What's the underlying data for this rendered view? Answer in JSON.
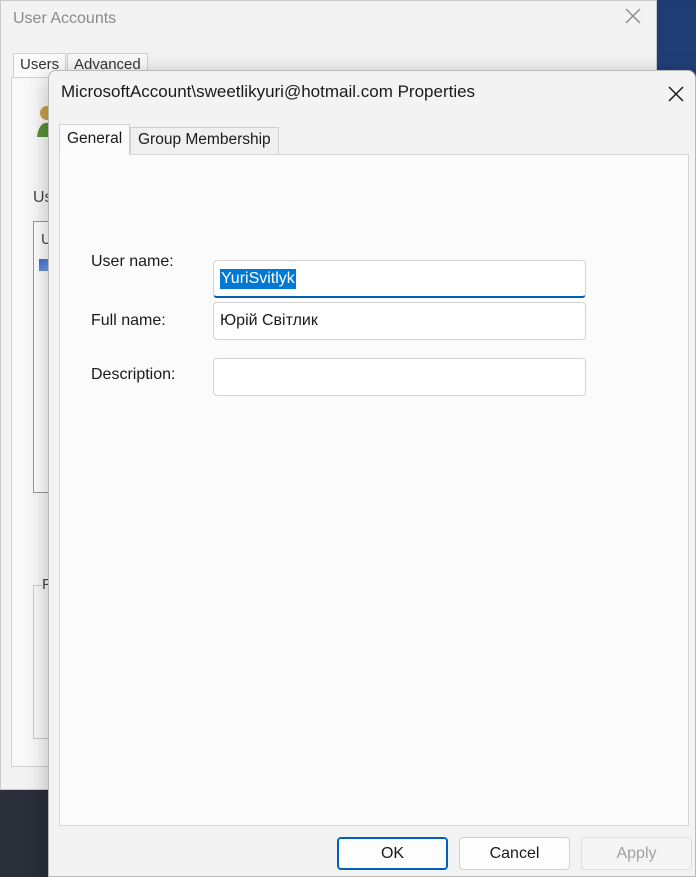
{
  "background_window": {
    "title": "User Accounts",
    "tabs": [
      "Users",
      "Advanced"
    ],
    "partial_label_users": "Us",
    "partial_list_text": "U",
    "partial_group_label": "P"
  },
  "dialog": {
    "title": "MicrosoftAccount\\sweetlikyuri@hotmail.com Properties",
    "tabs": [
      {
        "label": "General",
        "selected": true
      },
      {
        "label": "Group Membership",
        "selected": false
      }
    ],
    "fields": {
      "user_name": {
        "label": "User name:",
        "value": "YuriSvitlyk"
      },
      "full_name": {
        "label": "Full name:",
        "value": "Юрій Світлик"
      },
      "description": {
        "label": "Description:",
        "value": ""
      }
    },
    "buttons": {
      "ok": "OK",
      "cancel": "Cancel",
      "apply": "Apply"
    }
  },
  "colors": {
    "accent": "#005fb8",
    "selection": "#0078d4",
    "disabled_text": "#a0a0a0"
  }
}
